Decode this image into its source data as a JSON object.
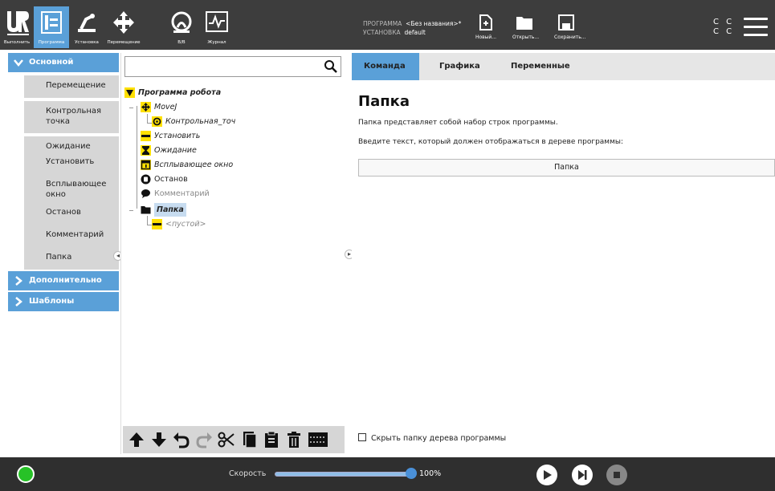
{
  "topbar": {
    "nav": [
      {
        "label": "Выполнить",
        "icon": "run-icon"
      },
      {
        "label": "Программа",
        "icon": "program-icon",
        "active": true
      },
      {
        "label": "Установка",
        "icon": "installation-icon"
      },
      {
        "label": "Перемещение",
        "icon": "move-icon"
      },
      {
        "label": "В/В",
        "icon": "io-icon"
      },
      {
        "label": "Журнал",
        "icon": "log-icon"
      }
    ],
    "program_label": "ПРОГРАММА",
    "program_value": "<Без названия>*",
    "install_label": "УСТАНОВКА",
    "install_value": "default",
    "new_label": "Новый...",
    "open_label": "Открыть...",
    "save_label": "Сохранить...",
    "cc_line1": "C C",
    "cc_line2": "C C"
  },
  "sidebar": {
    "basic_header": "Основной",
    "items": [
      "Перемещение",
      "Контрольная точка",
      "Ожидание",
      "Установить",
      "Всплывающее окно",
      "Останов",
      "Комментарий",
      "Папка"
    ],
    "advanced_header": "Дополнительно",
    "templates_header": "Шаблоны"
  },
  "tree": {
    "search_placeholder": "",
    "root": "Программа робота",
    "nodes": [
      {
        "label": "MoveJ",
        "icon": "move-icon"
      },
      {
        "label": "Контрольная_точ",
        "icon": "waypoint-icon"
      },
      {
        "label": "Установить",
        "icon": "set-icon"
      },
      {
        "label": "Ожидание",
        "icon": "hourglass-icon"
      },
      {
        "label": "Всплывающее окно",
        "icon": "popup-icon"
      },
      {
        "label": "Останов",
        "icon": "stop-hand-icon"
      },
      {
        "label": "Комментарий",
        "icon": "comment-icon"
      },
      {
        "label": "Папка",
        "icon": "folder-icon"
      },
      {
        "label": "<пустой>",
        "icon": "empty-icon"
      }
    ]
  },
  "right": {
    "tabs": [
      "Команда",
      "Графика",
      "Переменные"
    ],
    "title": "Папка",
    "desc1": "Папка представляет собой набор строк программы.",
    "desc2": "Введите текст, который должен отображаться в дереве программы:",
    "folder_name": "Папка",
    "hide_folder_label": "Скрыть папку дерева программы"
  },
  "bottombar": {
    "speed_label": "Скорость",
    "speed_value": "100%",
    "speed_fraction": 1.0
  },
  "colors": {
    "accent": "#5aa0d8",
    "topbar": "#3d3d3d",
    "bottombar": "#2f2f2f",
    "running": "#27c227"
  }
}
